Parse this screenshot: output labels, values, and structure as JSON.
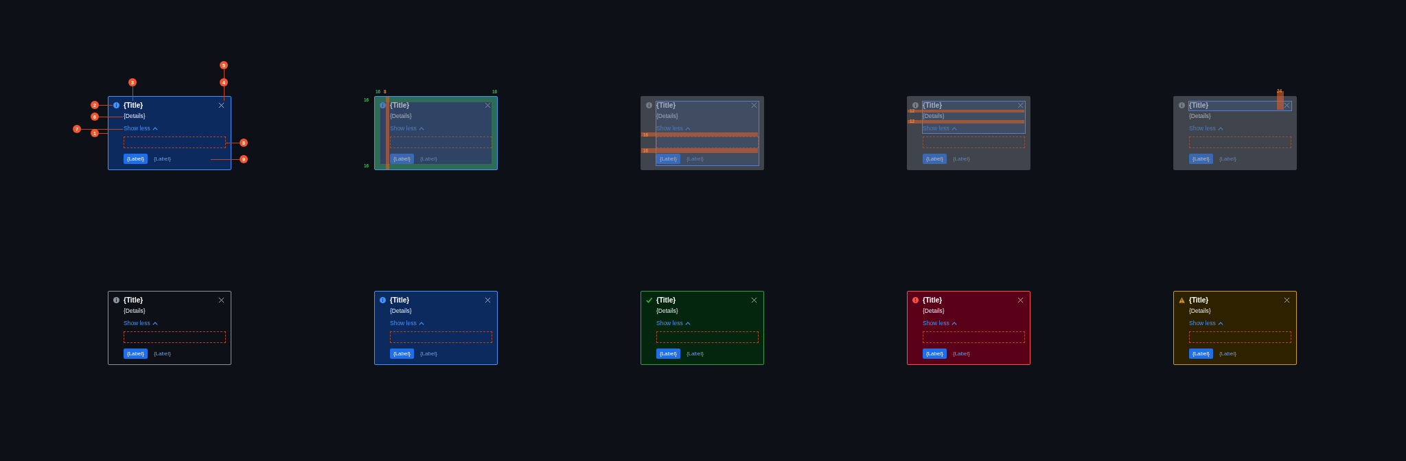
{
  "anatomy": {
    "markers": [
      "2",
      "3",
      "6",
      "7",
      "1",
      "5",
      "4",
      "8",
      "9"
    ],
    "card": {
      "kind": "info",
      "title": "{Title}",
      "details": "{Details}",
      "toggle": "Show less",
      "expanded": true,
      "primary": "{Label}",
      "secondary": "{Label}"
    }
  },
  "specs": [
    {
      "kind": "padding",
      "labels": [
        "16",
        "8",
        "16",
        "16",
        "16"
      ],
      "card": {
        "kind": "info",
        "title": "{Title}",
        "details": "{Details}",
        "toggle": "Show less",
        "expanded": true,
        "primary": "{Label}",
        "secondary": "{Label}"
      }
    },
    {
      "kind": "actions-gap",
      "labels": [
        "16",
        "16"
      ],
      "card": {
        "kind": "neutral",
        "title": "{Title}",
        "details": "{Details}",
        "toggle": "Show less",
        "expanded": true,
        "primary": "{Label}",
        "secondary": "{Label}"
      }
    },
    {
      "kind": "text-gap",
      "labels": [
        "12",
        "12"
      ],
      "card": {
        "kind": "neutral",
        "title": "{Title}",
        "details": "{Details}",
        "toggle": "Show less",
        "expanded": true,
        "primary": "{Label}",
        "secondary": "{Label}"
      }
    },
    {
      "kind": "close-size",
      "labels": [
        "24"
      ],
      "card": {
        "kind": "neutral",
        "title": "{Title}",
        "details": "{Details}",
        "toggle": "Show less",
        "expanded": true,
        "primary": "{Label}",
        "secondary": "{Label}"
      }
    }
  ],
  "variants": [
    {
      "kind": "neutral",
      "title": "{Title}",
      "details": "{Details}",
      "toggle": "Show less",
      "expanded": true,
      "primary": "{Label}",
      "secondary": "{Label}"
    },
    {
      "kind": "info",
      "title": "{Title}",
      "details": "{Details}",
      "toggle": "Show less",
      "expanded": true,
      "primary": "{Label}",
      "secondary": "{Label}"
    },
    {
      "kind": "success",
      "title": "{Title}",
      "details": "{Details}",
      "toggle": "Show less",
      "expanded": true,
      "primary": "{Label}",
      "secondary": "{Label}"
    },
    {
      "kind": "error",
      "title": "{Title}",
      "details": "{Details}",
      "toggle": "Show less",
      "expanded": true,
      "primary": "{Label}",
      "secondary": "{Label}"
    },
    {
      "kind": "warning",
      "title": "{Title}",
      "details": "{Details}",
      "toggle": "Show less",
      "expanded": true,
      "primary": "{Label}",
      "secondary": "{Label}"
    }
  ]
}
